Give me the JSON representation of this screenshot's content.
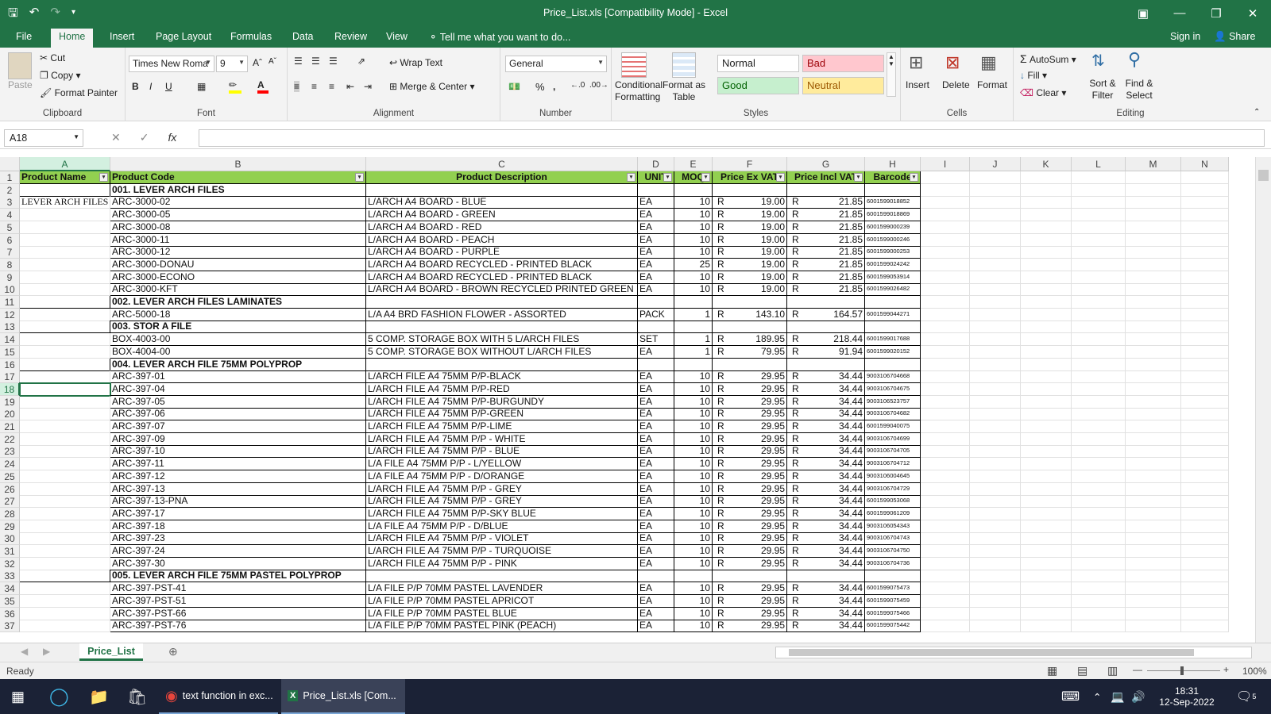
{
  "window": {
    "title": "Price_List.xls  [Compatibility Mode] - Excel"
  },
  "tabs": [
    "File",
    "Home",
    "Insert",
    "Page Layout",
    "Formulas",
    "Data",
    "Review",
    "View"
  ],
  "tell_me": "Tell me what you want to do...",
  "account": {
    "signin": "Sign in",
    "share": "Share"
  },
  "ribbon": {
    "clipboard": {
      "paste": "Paste",
      "cut": "Cut",
      "copy": "Copy",
      "format_painter": "Format Painter",
      "label": "Clipboard"
    },
    "font": {
      "name": "Times New Roma",
      "size": "9",
      "bold": "B",
      "italic": "I",
      "underline": "U",
      "label": "Font"
    },
    "alignment": {
      "wrap": "Wrap Text",
      "merge": "Merge & Center",
      "label": "Alignment"
    },
    "number": {
      "format": "General",
      "percent": "%",
      "comma": ",",
      "label": "Number"
    },
    "styles": {
      "conditional": "Conditional Formatting",
      "format_table": "Format as Table",
      "normal": "Normal",
      "bad": "Bad",
      "good": "Good",
      "neutral": "Neutral",
      "label": "Styles"
    },
    "cells": {
      "insert": "Insert",
      "delete": "Delete",
      "format": "Format",
      "label": "Cells"
    },
    "editing": {
      "autosum": "AutoSum",
      "fill": "Fill",
      "clear": "Clear",
      "sort": "Sort & Filter",
      "find": "Find & Select",
      "label": "Editing"
    }
  },
  "name_box": "A18",
  "columns": [
    "A",
    "B",
    "C",
    "D",
    "E",
    "F",
    "G",
    "H",
    "I",
    "J",
    "K",
    "L",
    "M",
    "N"
  ],
  "header_row": [
    "Product Name",
    "Product Code",
    "Product Description",
    "UNIT",
    "MOQ",
    "Price Ex VAT",
    "Price Incl VAT",
    "Barcode"
  ],
  "rows": [
    {
      "n": "2",
      "section": "001. LEVER ARCH FILES"
    },
    {
      "n": "3",
      "a": "LEVER ARCH FILES",
      "code": "ARC-3000-02",
      "desc": "L/ARCH A4 BOARD - BLUE",
      "unit": "EA",
      "moq": "10",
      "ex": "19.00",
      "inc": "21.85",
      "bar": "6001599018852"
    },
    {
      "n": "4",
      "code": "ARC-3000-05",
      "desc": "L/ARCH A4 BOARD - GREEN",
      "unit": "EA",
      "moq": "10",
      "ex": "19.00",
      "inc": "21.85",
      "bar": "6001599018869"
    },
    {
      "n": "5",
      "code": "ARC-3000-08",
      "desc": "L/ARCH A4 BOARD - RED",
      "unit": "EA",
      "moq": "10",
      "ex": "19.00",
      "inc": "21.85",
      "bar": "6001599000239"
    },
    {
      "n": "6",
      "code": "ARC-3000-11",
      "desc": "L/ARCH A4 BOARD - PEACH",
      "unit": "EA",
      "moq": "10",
      "ex": "19.00",
      "inc": "21.85",
      "bar": "6001599000246"
    },
    {
      "n": "7",
      "code": "ARC-3000-12",
      "desc": "L/ARCH A4 BOARD - PURPLE",
      "unit": "EA",
      "moq": "10",
      "ex": "19.00",
      "inc": "21.85",
      "bar": "6001599000253"
    },
    {
      "n": "8",
      "code": "ARC-3000-DONAU",
      "desc": "L/ARCH A4 BOARD RECYCLED - PRINTED BLACK",
      "unit": "EA",
      "moq": "25",
      "ex": "19.00",
      "inc": "21.85",
      "bar": "6001599024242"
    },
    {
      "n": "9",
      "code": "ARC-3000-ECONO",
      "desc": "L/ARCH A4 BOARD RECYCLED - PRINTED BLACK",
      "unit": "EA",
      "moq": "10",
      "ex": "19.00",
      "inc": "21.85",
      "bar": "6001599053914"
    },
    {
      "n": "10",
      "code": "ARC-3000-KFT",
      "desc": "L/ARCH A4 BOARD - BROWN RECYCLED PRINTED GREEN",
      "unit": "EA",
      "moq": "10",
      "ex": "19.00",
      "inc": "21.85",
      "bar": "6001599026482"
    },
    {
      "n": "11",
      "section": "002. LEVER ARCH FILES LAMINATES"
    },
    {
      "n": "12",
      "code": "ARC-5000-18",
      "desc": "L/A A4 BRD FASHION FLOWER - ASSORTED",
      "unit": "PACK",
      "moq": "1",
      "ex": "143.10",
      "inc": "164.57",
      "bar": "6001599044271"
    },
    {
      "n": "13",
      "section": "003. STOR A FILE"
    },
    {
      "n": "14",
      "code": "BOX-4003-00",
      "desc": "5 COMP. STORAGE BOX WITH 5 L/ARCH FILES",
      "unit": "SET",
      "moq": "1",
      "ex": "189.95",
      "inc": "218.44",
      "bar": "6001599017688"
    },
    {
      "n": "15",
      "code": "BOX-4004-00",
      "desc": "5 COMP. STORAGE BOX  WITHOUT L/ARCH FILES",
      "unit": "EA",
      "moq": "1",
      "ex": "79.95",
      "inc": "91.94",
      "bar": "6001599020152"
    },
    {
      "n": "16",
      "section": "004. LEVER ARCH FILE 75MM POLYPROP"
    },
    {
      "n": "17",
      "code": "ARC-397-01",
      "desc": "L/ARCH FILE A4 75MM P/P-BLACK",
      "unit": "EA",
      "moq": "10",
      "ex": "29.95",
      "inc": "34.44",
      "bar": "9003106704668"
    },
    {
      "n": "18",
      "code": "ARC-397-04",
      "desc": "L/ARCH FILE A4 75MM P/P-RED",
      "unit": "EA",
      "moq": "10",
      "ex": "29.95",
      "inc": "34.44",
      "bar": "9003106704675"
    },
    {
      "n": "19",
      "code": "ARC-397-05",
      "desc": "L/ARCH FILE A4 75MM P/P-BURGUNDY",
      "unit": "EA",
      "moq": "10",
      "ex": "29.95",
      "inc": "34.44",
      "bar": "9003106523757"
    },
    {
      "n": "20",
      "code": "ARC-397-06",
      "desc": "L/ARCH FILE A4 75MM P/P-GREEN",
      "unit": "EA",
      "moq": "10",
      "ex": "29.95",
      "inc": "34.44",
      "bar": "9003106704682"
    },
    {
      "n": "21",
      "code": "ARC-397-07",
      "desc": "L/ARCH FILE A4 75MM P/P-LIME",
      "unit": "EA",
      "moq": "10",
      "ex": "29.95",
      "inc": "34.44",
      "bar": "6001599040075"
    },
    {
      "n": "22",
      "code": "ARC-397-09",
      "desc": "L/ARCH FILE A4 75MM P/P - WHITE",
      "unit": "EA",
      "moq": "10",
      "ex": "29.95",
      "inc": "34.44",
      "bar": "9003106704699"
    },
    {
      "n": "23",
      "code": "ARC-397-10",
      "desc": "L/ARCH FILE A4 75MM P/P - BLUE",
      "unit": "EA",
      "moq": "10",
      "ex": "29.95",
      "inc": "34.44",
      "bar": "9003106704705"
    },
    {
      "n": "24",
      "code": "ARC-397-11",
      "desc": "L/A FILE A4 75MM P/P - L/YELLOW",
      "unit": "EA",
      "moq": "10",
      "ex": "29.95",
      "inc": "34.44",
      "bar": "9003106704712"
    },
    {
      "n": "25",
      "code": "ARC-397-12",
      "desc": "L/A  FILE A4 75MM P/P - D/ORANGE",
      "unit": "EA",
      "moq": "10",
      "ex": "29.95",
      "inc": "34.44",
      "bar": "9003106004645"
    },
    {
      "n": "26",
      "code": "ARC-397-13",
      "desc": "L/ARCH FILE A4 75MM P/P - GREY",
      "unit": "EA",
      "moq": "10",
      "ex": "29.95",
      "inc": "34.44",
      "bar": "9003106704729"
    },
    {
      "n": "27",
      "code": "ARC-397-13-PNA",
      "desc": "L/ARCH FILE A4 75MM P/P - GREY",
      "unit": "EA",
      "moq": "10",
      "ex": "29.95",
      "inc": "34.44",
      "bar": "6001599053068"
    },
    {
      "n": "28",
      "code": "ARC-397-17",
      "desc": "L/ARCH FILE A4 75MM P/P-SKY BLUE",
      "unit": "EA",
      "moq": "10",
      "ex": "29.95",
      "inc": "34.44",
      "bar": "6001599061209"
    },
    {
      "n": "29",
      "code": "ARC-397-18",
      "desc": "L/A FILE A4 75MM P/P - D/BLUE",
      "unit": "EA",
      "moq": "10",
      "ex": "29.95",
      "inc": "34.44",
      "bar": "9003106054343"
    },
    {
      "n": "30",
      "code": "ARC-397-23",
      "desc": "L/ARCH FILE A4 75MM P/P - VIOLET",
      "unit": "EA",
      "moq": "10",
      "ex": "29.95",
      "inc": "34.44",
      "bar": "9003106704743"
    },
    {
      "n": "31",
      "code": "ARC-397-24",
      "desc": "L/ARCH FILE A4 75MM P/P - TURQUOISE",
      "unit": "EA",
      "moq": "10",
      "ex": "29.95",
      "inc": "34.44",
      "bar": "9003106704750"
    },
    {
      "n": "32",
      "code": "ARC-397-30",
      "desc": "L/ARCH FILE A4 75MM P/P - PINK",
      "unit": "EA",
      "moq": "10",
      "ex": "29.95",
      "inc": "34.44",
      "bar": "9003106704736"
    },
    {
      "n": "33",
      "section": "005. LEVER ARCH FILE 75MM PASTEL POLYPROP"
    },
    {
      "n": "34",
      "code": "ARC-397-PST-41",
      "desc": "L/A FILE P/P 70MM PASTEL LAVENDER",
      "unit": "EA",
      "moq": "10",
      "ex": "29.95",
      "inc": "34.44",
      "bar": "6001599075473"
    },
    {
      "n": "35",
      "code": "ARC-397-PST-51",
      "desc": "L/A FILE P/P 70MM PASTEL APRICOT",
      "unit": "EA",
      "moq": "10",
      "ex": "29.95",
      "inc": "34.44",
      "bar": "6001599075459"
    },
    {
      "n": "36",
      "code": "ARC-397-PST-66",
      "desc": "L/A FILE P/P 70MM PASTEL BLUE",
      "unit": "EA",
      "moq": "10",
      "ex": "29.95",
      "inc": "34.44",
      "bar": "6001599075466"
    },
    {
      "n": "37",
      "code": "ARC-397-PST-76",
      "desc": "L/A FILE P/P 70MM PASTEL PINK (PEACH)",
      "unit": "EA",
      "moq": "10",
      "ex": "29.95",
      "inc": "34.44",
      "bar": "6001599075442"
    }
  ],
  "currency": "R",
  "sheet_tab": "Price_List",
  "status": {
    "ready": "Ready",
    "zoom": "100%"
  },
  "taskbar": {
    "chrome": "text function in exc...",
    "excel": "Price_List.xls  [Com...",
    "time": "18:31",
    "date": "12-Sep-2022",
    "notif": "5"
  },
  "colors": {
    "excel_green": "#217346",
    "header_green": "#92d050",
    "taskbar": "#1b2236"
  }
}
